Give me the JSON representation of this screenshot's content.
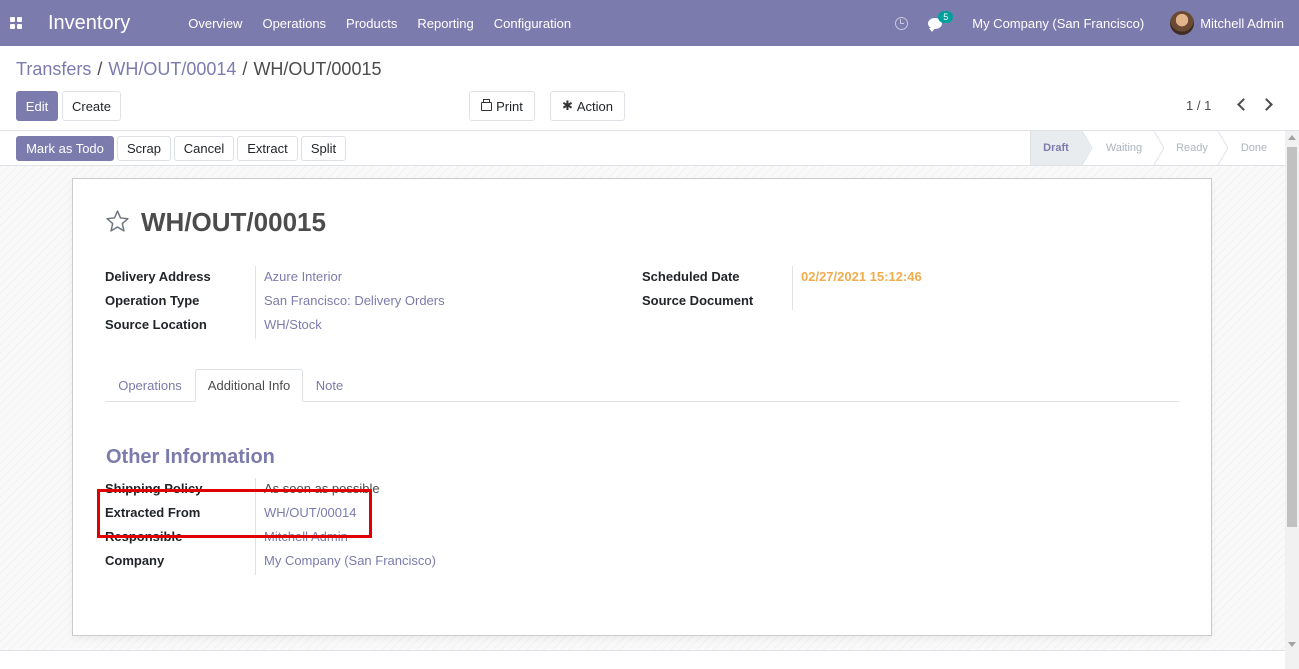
{
  "navbar": {
    "app_name": "Inventory",
    "menu": [
      "Overview",
      "Operations",
      "Products",
      "Reporting",
      "Configuration"
    ],
    "messages_count": "5",
    "company": "My Company (San Francisco)",
    "user": "Mitchell Admin"
  },
  "breadcrumb": {
    "items": [
      "Transfers",
      "WH/OUT/00014",
      "WH/OUT/00015"
    ],
    "separator": "/"
  },
  "control_panel": {
    "edit_label": "Edit",
    "create_label": "Create",
    "print_label": "Print",
    "action_label": "Action",
    "pager_value": "1 / 1"
  },
  "statusbar": {
    "buttons": [
      "Mark as Todo",
      "Scrap",
      "Cancel",
      "Extract",
      "Split"
    ],
    "stages": [
      "Draft",
      "Waiting",
      "Ready",
      "Done"
    ],
    "active_stage": "Draft"
  },
  "record": {
    "title": "WH/OUT/00015",
    "fields_left": [
      {
        "label": "Delivery Address",
        "value": "Azure Interior"
      },
      {
        "label": "Operation Type",
        "value": "San Francisco: Delivery Orders"
      },
      {
        "label": "Source Location",
        "value": "WH/Stock"
      }
    ],
    "fields_right": [
      {
        "label": "Scheduled Date",
        "value": "02/27/2021 15:12:46"
      },
      {
        "label": "Source Document",
        "value": ""
      }
    ]
  },
  "tabs": {
    "items": [
      "Operations",
      "Additional Info",
      "Note"
    ],
    "active": "Additional Info"
  },
  "other_information": {
    "title": "Other Information",
    "fields": [
      {
        "label": "Shipping Policy",
        "value": "As soon as possible"
      },
      {
        "label": "Extracted From",
        "value": "WH/OUT/00014"
      },
      {
        "label": "Responsible",
        "value": "Mitchell Admin"
      },
      {
        "label": "Company",
        "value": "My Company (San Francisco)"
      }
    ]
  },
  "colors": {
    "brand": "#7c7bad",
    "date": "#f0ad4e",
    "highlight": "#e00000"
  }
}
